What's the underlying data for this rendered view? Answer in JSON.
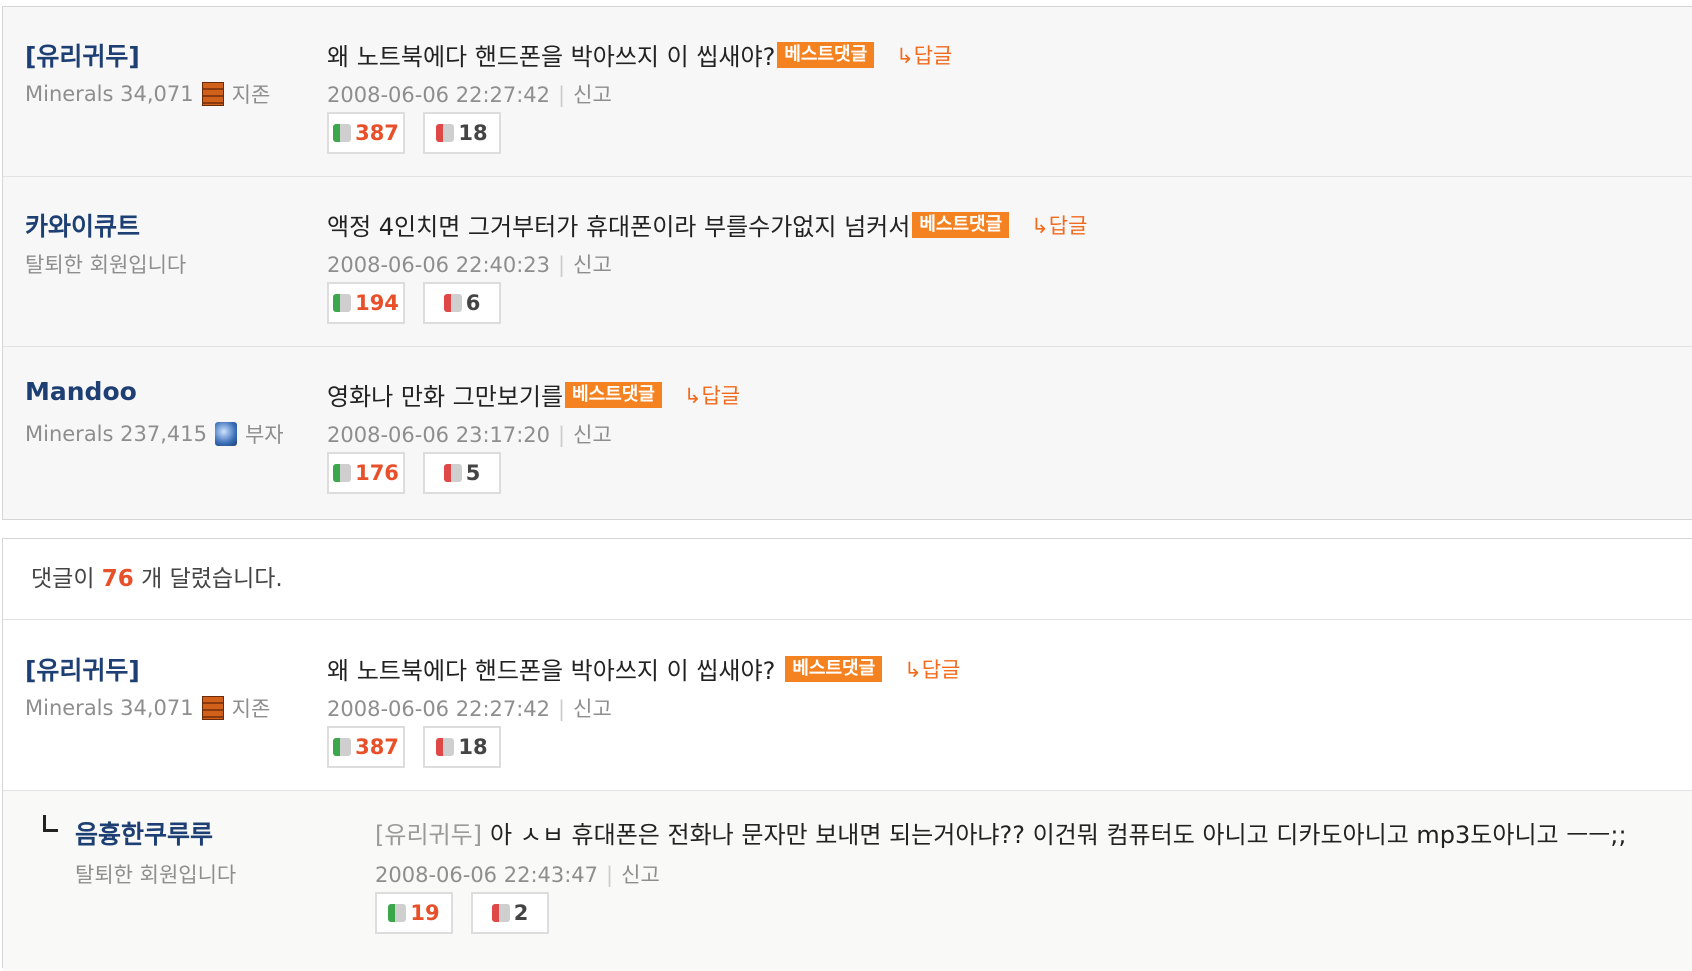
{
  "best_comments": [
    {
      "author": "[유리귀두]",
      "meta": "Minerals 34,071",
      "rank_icon": "brick-rank-icon",
      "rank": "지존",
      "text": "왜 노트북에다 핸드폰을 박아쓰지 이 씹새야?",
      "badge": "베스트댓글",
      "reply": "↳답글",
      "date": "2008-06-06 22:27:42",
      "report": "신고",
      "up": "387",
      "down": "18"
    },
    {
      "author": "카와이큐트",
      "meta": "탈퇴한 회원입니다",
      "rank_icon": "",
      "rank": "",
      "text": "액정 4인치면 그거부터가 휴대폰이라 부를수가없지 넘커서",
      "badge": "베스트댓글",
      "reply": "↳답글",
      "date": "2008-06-06 22:40:23",
      "report": "신고",
      "up": "194",
      "down": "6"
    },
    {
      "author": "Mandoo",
      "meta": "Minerals 237,415",
      "rank_icon": "gem-rank-icon",
      "rank": "부자",
      "text": "영화나 만화 그만보기를",
      "badge": "베스트댓글",
      "reply": "↳답글",
      "date": "2008-06-06 23:17:20",
      "report": "신고",
      "up": "176",
      "down": "5"
    }
  ],
  "comment_count": {
    "prefix": "댓글이",
    "count": "76",
    "suffix": "개 달렸습니다."
  },
  "comment": {
    "author": "[유리귀두]",
    "meta": "Minerals 34,071",
    "rank": "지존",
    "text": "왜 노트북에다 핸드폰을 박아쓰지 이 씹새야?",
    "badge": "베스트댓글",
    "reply": "↳답글",
    "date": "2008-06-06 22:27:42",
    "report": "신고",
    "up": "387",
    "down": "18"
  },
  "reply_comment": {
    "author": "음흉한쿠루루",
    "meta": "탈퇴한 회원입니다",
    "mention": "[유리귀두]",
    "text": "아 ㅅㅂ 휴대폰은 전화나 문자만 보내면 되는거아냐?? 이건뭐 컴퓨터도 아니고 디카도아니고 mp3도아니고 ㅡㅡ;;",
    "date": "2008-06-06 22:43:47",
    "report": "신고",
    "up": "19",
    "down": "2"
  }
}
